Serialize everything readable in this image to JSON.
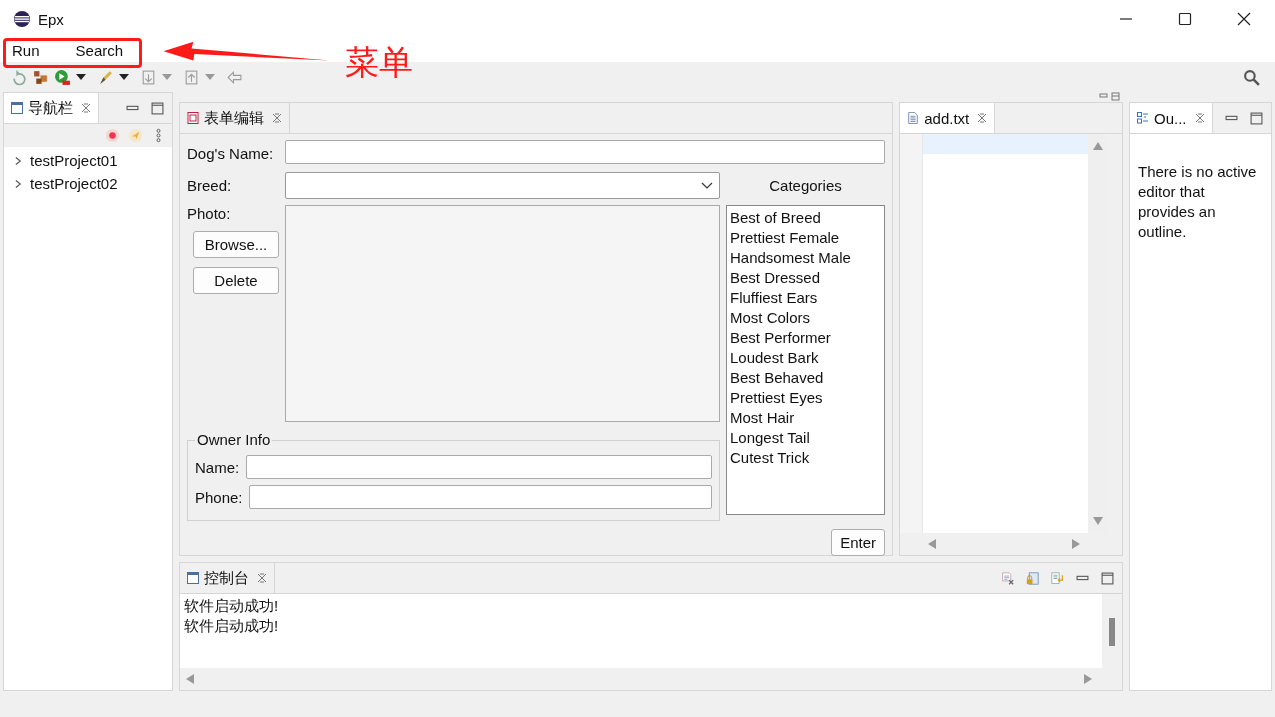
{
  "window": {
    "title": "Epx"
  },
  "menu": [
    {
      "label": "Run"
    },
    {
      "label": "Search"
    }
  ],
  "annotation": {
    "label": "菜单"
  },
  "navigator": {
    "tab": "导航栏",
    "items": [
      {
        "label": "testProject01",
        "expanded": false
      },
      {
        "label": "testProject02",
        "expanded": false
      }
    ]
  },
  "form_editor": {
    "tab": "表单编辑",
    "dog_name": {
      "label": "Dog's Name:"
    },
    "breed": {
      "label": "Breed:"
    },
    "photo": {
      "label": "Photo:"
    },
    "photo_buttons": [
      "Browse...",
      "Delete"
    ],
    "owner_info": {
      "title": "Owner Info",
      "fields": [
        {
          "label": "Name:"
        },
        {
          "label": "Phone:"
        }
      ]
    },
    "categories": {
      "title": "Categories",
      "items": [
        "Best of Breed",
        "Prettiest Female",
        "Handsomest Male",
        "Best Dressed",
        "Fluffiest Ears",
        "Most Colors",
        "Best Performer",
        "Loudest Bark",
        "Best Behaved",
        "Prettiest Eyes",
        "Most Hair",
        "Longest Tail",
        "Cutest Trick"
      ]
    },
    "enter_button": "Enter"
  },
  "text_editor": {
    "tab": "add.txt"
  },
  "outline": {
    "tab": "Ou...",
    "message": "There is no active editor that provides an outline."
  },
  "console": {
    "tab": "控制台",
    "lines": [
      "软件启动成功!",
      "软件启动成功!"
    ]
  }
}
